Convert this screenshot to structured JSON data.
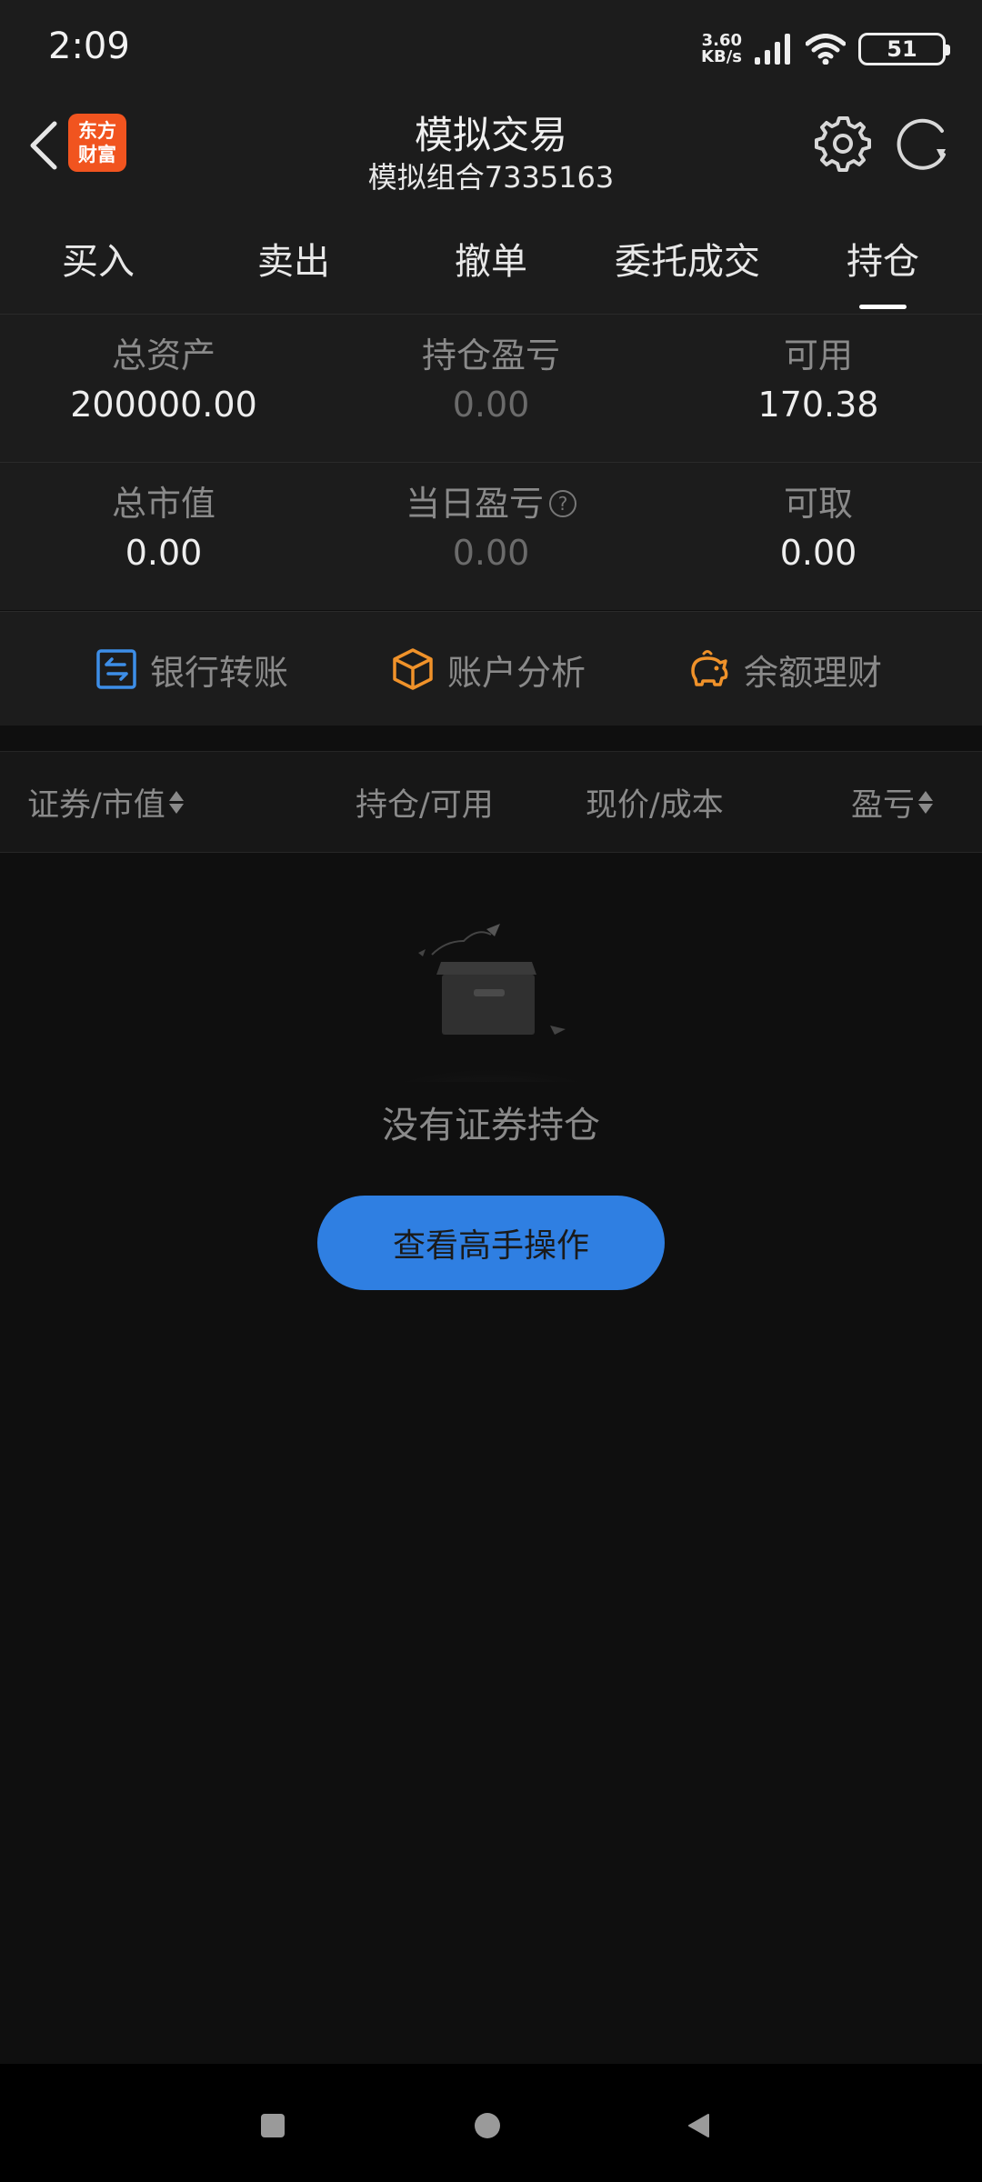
{
  "status_bar": {
    "time": "2:09",
    "net_speed_value": "3.60",
    "net_speed_unit": "KB/s",
    "battery_level": "51"
  },
  "header": {
    "brand_line1": "东方",
    "brand_line2": "财富",
    "title": "模拟交易",
    "subtitle": "模拟组合7335163"
  },
  "tabs": [
    {
      "label": "买入"
    },
    {
      "label": "卖出"
    },
    {
      "label": "撤单"
    },
    {
      "label": "委托成交"
    },
    {
      "label": "持仓",
      "selected": true
    }
  ],
  "summary": [
    [
      {
        "label": "总资产",
        "value": "200000.00"
      },
      {
        "label": "持仓盈亏",
        "value": "0.00"
      },
      {
        "label": "可用",
        "value": "170.38"
      }
    ],
    [
      {
        "label": "总市值",
        "value": "0.00"
      },
      {
        "label": "当日盈亏",
        "value": "0.00"
      },
      {
        "label": "可取",
        "value": "0.00"
      }
    ]
  ],
  "quick_actions": [
    {
      "label": "银行转账",
      "icon": "bank-transfer-icon",
      "color": "#3d8ee8"
    },
    {
      "label": "账户分析",
      "icon": "cube-icon",
      "color": "#f0922a"
    },
    {
      "label": "余额理财",
      "icon": "piggy-bank-icon",
      "color": "#f0922a"
    }
  ],
  "table": {
    "columns": [
      "证券/市值",
      "持仓/可用",
      "现价/成本",
      "盈亏"
    ]
  },
  "empty_state": {
    "message": "没有证券持仓",
    "button_label": "查看高手操作"
  },
  "colors": {
    "accent_blue": "#2f7fe2",
    "brand_orange": "#f1541f",
    "icon_orange": "#f0922a",
    "icon_blue": "#3d8ee8"
  }
}
